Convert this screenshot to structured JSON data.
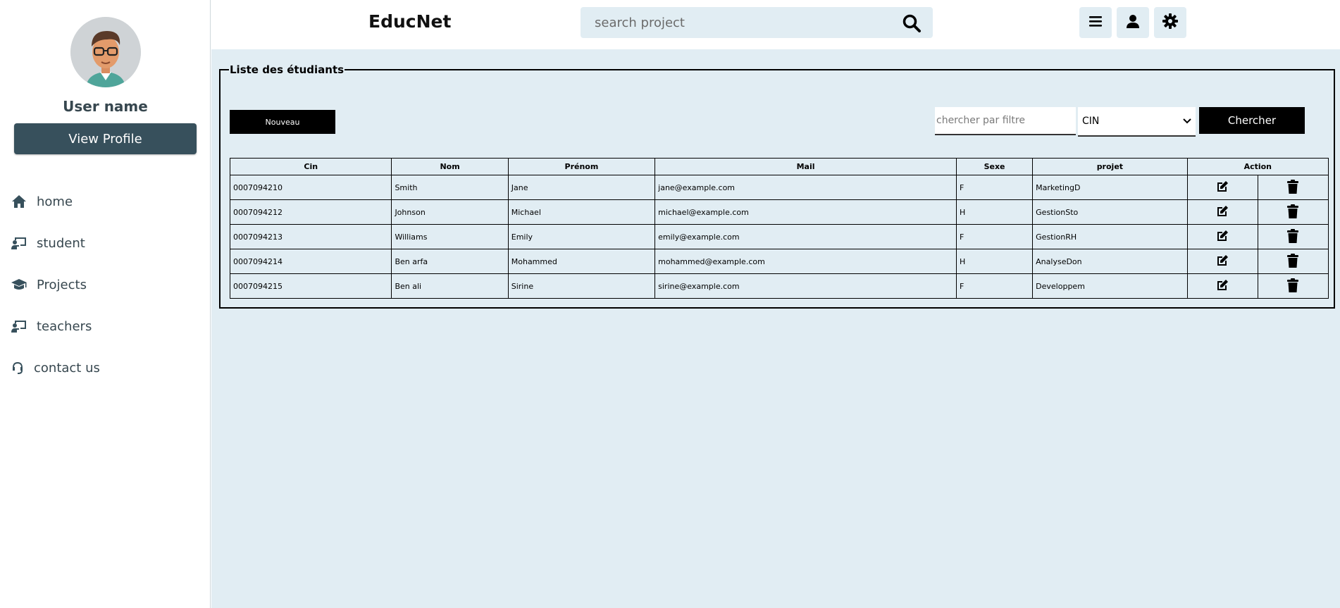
{
  "sidebar": {
    "username": "User name",
    "view_profile": "View Profile",
    "nav": [
      {
        "label": "home",
        "icon": "home-icon"
      },
      {
        "label": "student",
        "icon": "student-board-icon"
      },
      {
        "label": "Projects",
        "icon": "graduation-cap-icon"
      },
      {
        "label": "teachers",
        "icon": "teacher-board-icon"
      },
      {
        "label": "contact us",
        "icon": "headset-icon"
      }
    ]
  },
  "header": {
    "brand": "EducNet",
    "search_placeholder": "search project"
  },
  "panel": {
    "legend": "Liste des étudiants",
    "new_button": "Nouveau",
    "filter_placeholder": "chercher par filtre",
    "filter_select_value": "CIN",
    "search_button": "Chercher"
  },
  "table": {
    "headers": [
      "Cin",
      "Nom",
      "Prénom",
      "Mail",
      "Sexe",
      "projet",
      "Action"
    ],
    "rows": [
      [
        "0007094210",
        "Smith",
        "Jane",
        "jane@example.com",
        "F",
        "MarketingD"
      ],
      [
        "0007094212",
        "Johnson",
        "Michael",
        "michael@example.com",
        "H",
        "GestionSto"
      ],
      [
        "0007094213",
        "Williams",
        "Emily",
        "emily@example.com",
        "F",
        "GestionRH"
      ],
      [
        "0007094214",
        "Ben arfa",
        "Mohammed",
        "mohammed@example.com",
        "H",
        "AnalyseDon"
      ],
      [
        "0007094215",
        "Ben ali",
        "Sirine",
        "sirine@example.com",
        "F",
        "Developpem"
      ]
    ]
  },
  "colors": {
    "sidebar_accent": "#37505c",
    "main_background": "#e1edf3",
    "button_dark": "#000000"
  }
}
